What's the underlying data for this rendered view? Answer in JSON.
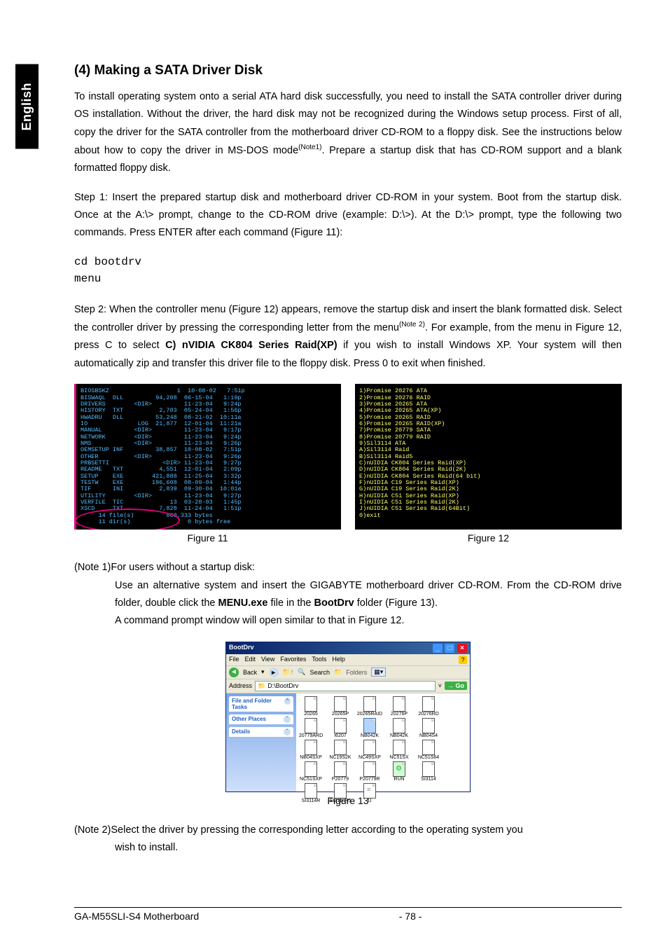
{
  "lang_tab": "English",
  "section_title": "(4)  Making a SATA Driver Disk",
  "para1": "To install operating system onto a serial ATA hard disk successfully, you need to install the SATA controller driver during OS installation. Without the driver, the hard disk may not be recognized during the Windows setup process.  First of all, copy the driver for the SATA controller from the motherboard driver CD-ROM to a floppy disk. See the instructions below about how to copy the driver in MS-DOS mode",
  "note1_sup": "(Note1)",
  "para1_tail": ". Prepare a startup disk that has CD-ROM support and a blank formatted floppy disk.",
  "para2": "Step 1: Insert the prepared startup disk and motherboard driver CD-ROM in your system.  Boot from the startup disk. Once at the A:\\> prompt, change to the CD-ROM drive (example: D:\\>).  At the D:\\> prompt, type the following two commands. Press ENTER after each command (Figure 11):",
  "mono1": "cd bootdrv",
  "mono2": "menu",
  "para3_a": "Step 2: When the controller menu (Figure 12) appears, remove the startup disk and insert the blank formatted disk.  Select the controller driver by pressing the corresponding letter from the menu",
  "note2_sup": "(Note 2)",
  "para3_b": ". For example, from the menu in Figure 12, press C to select ",
  "para3_bold": "C) nVIDIA CK804 Series Raid(XP)",
  "para3_c": " if you wish to install Windows XP. Your system will then automatically zip and transfer this driver file to the floppy disk. Press 0 to exit when finished.",
  "fig11_text": "BIOSBSKZ                   1  10-08-02   7:51p\nBISWAQL  DLL         94,208  06-15-04   1:19p\nDRIVERS        <DIR>         11-23-04   9:24p\nHISTORY  TXT          2,703  05-24-04   1:56p\nHWADRU   DLL         53,248  08-21-02  10:11a\nIO              LOG  21,877  12-01-04  11:21a\nMANUAL         <DIR>         11-23-04   9:17p\nNETWORK        <DIR>         11-23-04   9:24p\nNMS            <DIR>         11-23-04   9:26p\nOEMSETUP INF         38,857  10-08-02   7:51p\nOTHER          <DIR>         11-23-04   9:26p\nPRBSETTI               <DIR> 11-23-04   9:27p\nREADME   TXT          4,551  12-01-04   2:09p\nSETUP    EXE        421,888  11-25-04   3:32p\nTESTW    EXE        196,608  08-09-04   1:44p\nTIF      INI          2,839  09-30-04  10:01a\nUTILITY        <DIR>         11-23-04   9:27p\nVERFILE  TIC             13  03-28-03   1:45p\nXSCD     TXT          7,828  11-24-04   1:51p\n     14 file(s)         860,333 bytes\n     11 dir(s)                0 bytes free\n\nD:\\>cd bootdrv\n\nD:\\BOOTDRV>menu_",
  "fig12_text": "1)Promise 20276 ATA\n2)Promise 20276 RAID\n3)Promise 20265 ATA\n4)Promise 20265 ATA(XP)\n5)Promise 20265 RAID\n6)Promise 20265 RAID(XP)\n7)Promise 20779 SATA\n8)Promise 20779 RAID\n9)Sil3114 ATA\nA)Sil3114 Raid\nB)Sil3114 Raid5\nC)nUIDIA CK804 Series Raid(XP)\nD)nUIDIA CK804 Series Raid(2K)\nE)nUIDIA CK804 Series Raid(64 bit)\nF)nUIDIA C19 Series Raid(XP)\nG)nUIDIA C19 Series Raid(2K)\nH)nUIDIA C51 Series Raid(XP)\nI)nUIDIA C51 Series Raid(2K)\nJ)nUIDIA C51 Series Raid(64Bit)\n0)exit",
  "fig11_caption": "Figure 11",
  "fig12_caption": "Figure 12",
  "note1_label": "(Note 1) ",
  "note1_a": "For users without a startup disk:",
  "note1_b": "Use an alternative system and insert the GIGABYTE motherboard driver CD-ROM. From the CD-ROM drive folder, double click the ",
  "note1_bold1": "MENU.exe",
  "note1_c": " file in the ",
  "note1_bold2": "BootDrv",
  "note1_d": " folder (Figure 13).",
  "note1_e": "A command prompt window will open similar to that in Figure 12.",
  "explorer": {
    "title": "BootDrv",
    "menu": [
      "File",
      "Edit",
      "View",
      "Favorites",
      "Tools",
      "Help"
    ],
    "back": "Back",
    "search": "Search",
    "folders": "Folders",
    "addr_label": "Address",
    "addr_path": "D:\\BootDrv",
    "go": "Go",
    "side1": "File and Folder Tasks",
    "side2": "Other Places",
    "side3": "Details",
    "files": [
      "20265",
      "20265P",
      "20265RAID",
      "20276P",
      "20276RD",
      "20779ARD",
      "I6207",
      "NB042K",
      "NB042K",
      "NB04S4",
      "NB04SXP",
      "NC19S2K",
      "NC49SXP",
      "NC51SX",
      "NC51S64",
      "NC51SXP",
      "P20779",
      "P20779R",
      "RUN",
      "SI3114",
      "SI3114R",
      "SI3114R5",
      "U"
    ]
  },
  "fig13_caption": "Figure 13",
  "note2_label": "(Note 2) ",
  "note2_text": "Select the driver by pressing the corresponding letter according to the operating system you wish to install.",
  "footer_left": "GA-M55SLI-S4 Motherboard",
  "footer_page": "- 78 -"
}
